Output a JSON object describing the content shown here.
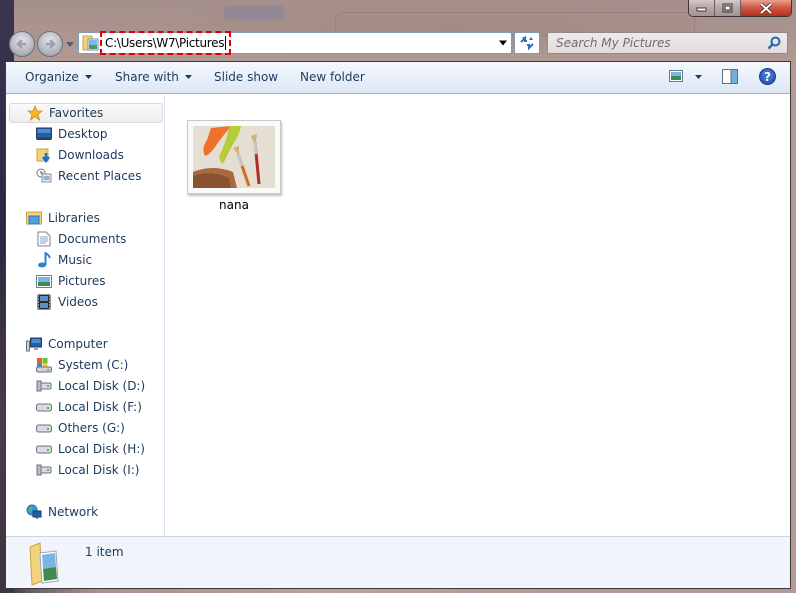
{
  "window": {
    "caption_buttons": [
      "minimize",
      "maximize",
      "close"
    ]
  },
  "navbar": {
    "address_path": "C:\\Users\\W7\\Pictures",
    "search_placeholder": "Search My Pictures",
    "back_icon": "back-arrow-icon",
    "forward_icon": "forward-arrow-icon",
    "refresh_icon": "refresh-icon",
    "search_icon": "magnifier-icon"
  },
  "toolbar": {
    "organize": "Organize",
    "share_with": "Share with",
    "slide_show": "Slide show",
    "new_folder": "New folder",
    "view_icon": "picture-view-icon",
    "preview_pane_icon": "preview-pane-icon",
    "help_icon": "help-icon"
  },
  "sidebar": {
    "favorites": {
      "label": "Favorites",
      "items": [
        {
          "label": "Desktop",
          "icon": "desktop-icon"
        },
        {
          "label": "Downloads",
          "icon": "downloads-icon"
        },
        {
          "label": "Recent Places",
          "icon": "recent-places-icon"
        }
      ]
    },
    "libraries": {
      "label": "Libraries",
      "items": [
        {
          "label": "Documents",
          "icon": "documents-icon"
        },
        {
          "label": "Music",
          "icon": "music-icon"
        },
        {
          "label": "Pictures",
          "icon": "pictures-icon"
        },
        {
          "label": "Videos",
          "icon": "videos-icon"
        }
      ]
    },
    "computer": {
      "label": "Computer",
      "items": [
        {
          "label": "System (C:)",
          "icon": "system-drive-icon"
        },
        {
          "label": "Local Disk (D:)",
          "icon": "usb-drive-icon"
        },
        {
          "label": "Local Disk (F:)",
          "icon": "hard-drive-icon"
        },
        {
          "label": "Others (G:)",
          "icon": "hard-drive-icon"
        },
        {
          "label": "Local Disk (H:)",
          "icon": "hard-drive-icon"
        },
        {
          "label": "Local Disk (I:)",
          "icon": "usb-drive-icon"
        }
      ]
    },
    "network": {
      "label": "Network"
    }
  },
  "content": {
    "files": [
      {
        "name": "nana",
        "type": "image"
      }
    ]
  },
  "status": {
    "item_count": "1 item"
  }
}
